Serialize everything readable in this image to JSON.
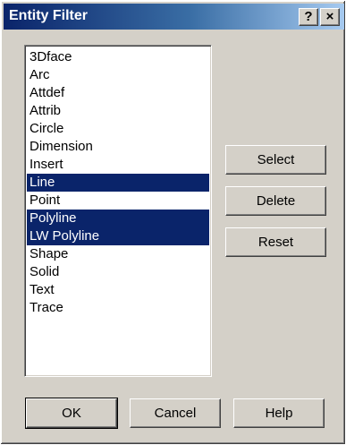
{
  "window": {
    "title": "Entity Filter",
    "help_glyph": "?",
    "close_glyph": "×"
  },
  "entity_list": {
    "items": [
      {
        "label": "3Dface",
        "selected": false
      },
      {
        "label": "Arc",
        "selected": false
      },
      {
        "label": "Attdef",
        "selected": false
      },
      {
        "label": "Attrib",
        "selected": false
      },
      {
        "label": "Circle",
        "selected": false
      },
      {
        "label": "Dimension",
        "selected": false
      },
      {
        "label": "Insert",
        "selected": false
      },
      {
        "label": "Line",
        "selected": true
      },
      {
        "label": "Point",
        "selected": false
      },
      {
        "label": "Polyline",
        "selected": true
      },
      {
        "label": "LW Polyline",
        "selected": true
      },
      {
        "label": "Shape",
        "selected": false
      },
      {
        "label": "Solid",
        "selected": false
      },
      {
        "label": "Text",
        "selected": false
      },
      {
        "label": "Trace",
        "selected": false
      }
    ]
  },
  "actions": {
    "select_label": "Select",
    "delete_label": "Delete",
    "reset_label": "Reset"
  },
  "footer": {
    "ok_label": "OK",
    "cancel_label": "Cancel",
    "help_label": "Help"
  },
  "colors": {
    "title_bar_start": "#0a246a",
    "title_bar_end": "#a6caf0",
    "selection": "#0a246a",
    "dialog_face": "#d4d0c8"
  }
}
